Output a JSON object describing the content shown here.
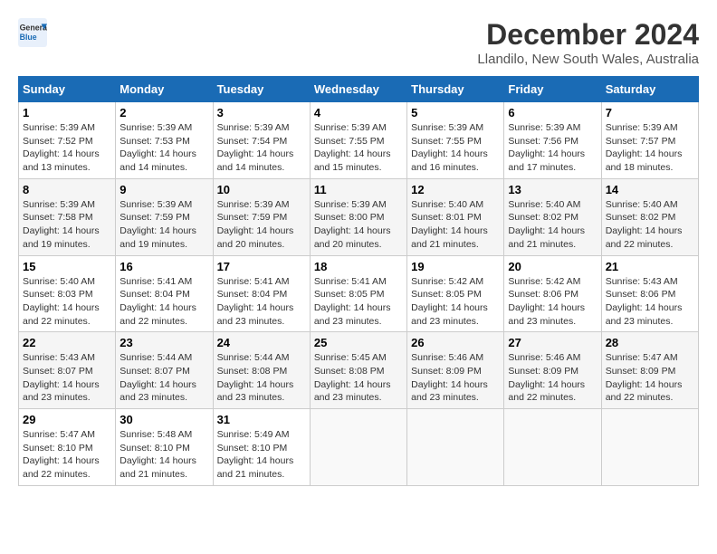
{
  "logo": {
    "line1": "General",
    "line2": "Blue"
  },
  "title": "December 2024",
  "subtitle": "Llandilo, New South Wales, Australia",
  "days_of_week": [
    "Sunday",
    "Monday",
    "Tuesday",
    "Wednesday",
    "Thursday",
    "Friday",
    "Saturday"
  ],
  "weeks": [
    [
      {
        "day": "1",
        "sunrise": "5:39 AM",
        "sunset": "7:52 PM",
        "daylight": "14 hours and 13 minutes."
      },
      {
        "day": "2",
        "sunrise": "5:39 AM",
        "sunset": "7:53 PM",
        "daylight": "14 hours and 14 minutes."
      },
      {
        "day": "3",
        "sunrise": "5:39 AM",
        "sunset": "7:54 PM",
        "daylight": "14 hours and 14 minutes."
      },
      {
        "day": "4",
        "sunrise": "5:39 AM",
        "sunset": "7:55 PM",
        "daylight": "14 hours and 15 minutes."
      },
      {
        "day": "5",
        "sunrise": "5:39 AM",
        "sunset": "7:55 PM",
        "daylight": "14 hours and 16 minutes."
      },
      {
        "day": "6",
        "sunrise": "5:39 AM",
        "sunset": "7:56 PM",
        "daylight": "14 hours and 17 minutes."
      },
      {
        "day": "7",
        "sunrise": "5:39 AM",
        "sunset": "7:57 PM",
        "daylight": "14 hours and 18 minutes."
      }
    ],
    [
      {
        "day": "8",
        "sunrise": "5:39 AM",
        "sunset": "7:58 PM",
        "daylight": "14 hours and 19 minutes."
      },
      {
        "day": "9",
        "sunrise": "5:39 AM",
        "sunset": "7:59 PM",
        "daylight": "14 hours and 19 minutes."
      },
      {
        "day": "10",
        "sunrise": "5:39 AM",
        "sunset": "7:59 PM",
        "daylight": "14 hours and 20 minutes."
      },
      {
        "day": "11",
        "sunrise": "5:39 AM",
        "sunset": "8:00 PM",
        "daylight": "14 hours and 20 minutes."
      },
      {
        "day": "12",
        "sunrise": "5:40 AM",
        "sunset": "8:01 PM",
        "daylight": "14 hours and 21 minutes."
      },
      {
        "day": "13",
        "sunrise": "5:40 AM",
        "sunset": "8:02 PM",
        "daylight": "14 hours and 21 minutes."
      },
      {
        "day": "14",
        "sunrise": "5:40 AM",
        "sunset": "8:02 PM",
        "daylight": "14 hours and 22 minutes."
      }
    ],
    [
      {
        "day": "15",
        "sunrise": "5:40 AM",
        "sunset": "8:03 PM",
        "daylight": "14 hours and 22 minutes."
      },
      {
        "day": "16",
        "sunrise": "5:41 AM",
        "sunset": "8:04 PM",
        "daylight": "14 hours and 22 minutes."
      },
      {
        "day": "17",
        "sunrise": "5:41 AM",
        "sunset": "8:04 PM",
        "daylight": "14 hours and 23 minutes."
      },
      {
        "day": "18",
        "sunrise": "5:41 AM",
        "sunset": "8:05 PM",
        "daylight": "14 hours and 23 minutes."
      },
      {
        "day": "19",
        "sunrise": "5:42 AM",
        "sunset": "8:05 PM",
        "daylight": "14 hours and 23 minutes."
      },
      {
        "day": "20",
        "sunrise": "5:42 AM",
        "sunset": "8:06 PM",
        "daylight": "14 hours and 23 minutes."
      },
      {
        "day": "21",
        "sunrise": "5:43 AM",
        "sunset": "8:06 PM",
        "daylight": "14 hours and 23 minutes."
      }
    ],
    [
      {
        "day": "22",
        "sunrise": "5:43 AM",
        "sunset": "8:07 PM",
        "daylight": "14 hours and 23 minutes."
      },
      {
        "day": "23",
        "sunrise": "5:44 AM",
        "sunset": "8:07 PM",
        "daylight": "14 hours and 23 minutes."
      },
      {
        "day": "24",
        "sunrise": "5:44 AM",
        "sunset": "8:08 PM",
        "daylight": "14 hours and 23 minutes."
      },
      {
        "day": "25",
        "sunrise": "5:45 AM",
        "sunset": "8:08 PM",
        "daylight": "14 hours and 23 minutes."
      },
      {
        "day": "26",
        "sunrise": "5:46 AM",
        "sunset": "8:09 PM",
        "daylight": "14 hours and 23 minutes."
      },
      {
        "day": "27",
        "sunrise": "5:46 AM",
        "sunset": "8:09 PM",
        "daylight": "14 hours and 22 minutes."
      },
      {
        "day": "28",
        "sunrise": "5:47 AM",
        "sunset": "8:09 PM",
        "daylight": "14 hours and 22 minutes."
      }
    ],
    [
      {
        "day": "29",
        "sunrise": "5:47 AM",
        "sunset": "8:10 PM",
        "daylight": "14 hours and 22 minutes."
      },
      {
        "day": "30",
        "sunrise": "5:48 AM",
        "sunset": "8:10 PM",
        "daylight": "14 hours and 21 minutes."
      },
      {
        "day": "31",
        "sunrise": "5:49 AM",
        "sunset": "8:10 PM",
        "daylight": "14 hours and 21 minutes."
      },
      null,
      null,
      null,
      null
    ]
  ],
  "labels": {
    "sunrise": "Sunrise:",
    "sunset": "Sunset:",
    "daylight": "Daylight:"
  }
}
